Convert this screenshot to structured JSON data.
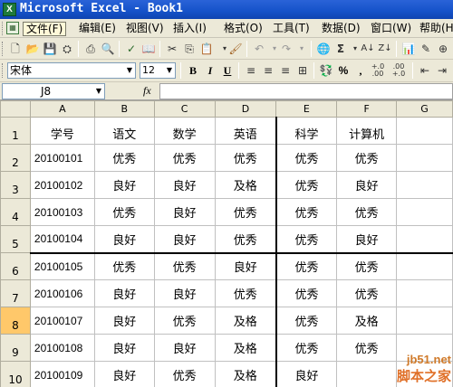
{
  "app": {
    "title": "Microsoft Excel - Book1",
    "icon": "excel-icon"
  },
  "menu": [
    "文件(F)",
    "编辑(E)",
    "视图(V)",
    "插入(I)",
    "格式(O)",
    "工具(T)",
    "数据(D)",
    "窗口(W)",
    "帮助(H)"
  ],
  "format_toolbar": {
    "font": "宋体",
    "size": "12",
    "bold": "B",
    "italic": "I",
    "underline": "U",
    "percent": "%",
    "comma": ",",
    "inc_decimal": "+.0\n.00",
    "dec_decimal": ".00\n+.0"
  },
  "formula_bar": {
    "name_box": "J8",
    "fx": "fx",
    "value": ""
  },
  "columns": [
    "A",
    "B",
    "C",
    "D",
    "E",
    "F",
    "G"
  ],
  "rows": [
    {
      "num": "1",
      "cells": [
        "学号",
        "语文",
        "数学",
        "英语",
        "科学",
        "计算机",
        ""
      ]
    },
    {
      "num": "2",
      "cells": [
        "20100101",
        "优秀",
        "优秀",
        "优秀",
        "优秀",
        "优秀",
        ""
      ]
    },
    {
      "num": "3",
      "cells": [
        "20100102",
        "良好",
        "良好",
        "及格",
        "优秀",
        "良好",
        ""
      ]
    },
    {
      "num": "4",
      "cells": [
        "20100103",
        "优秀",
        "良好",
        "优秀",
        "优秀",
        "优秀",
        ""
      ]
    },
    {
      "num": "5",
      "cells": [
        "20100104",
        "良好",
        "良好",
        "优秀",
        "优秀",
        "良好",
        ""
      ]
    },
    {
      "num": "6",
      "cells": [
        "20100105",
        "优秀",
        "优秀",
        "良好",
        "优秀",
        "优秀",
        ""
      ]
    },
    {
      "num": "7",
      "cells": [
        "20100106",
        "良好",
        "良好",
        "优秀",
        "优秀",
        "优秀",
        ""
      ]
    },
    {
      "num": "8",
      "cells": [
        "20100107",
        "良好",
        "优秀",
        "及格",
        "优秀",
        "及格",
        ""
      ]
    },
    {
      "num": "9",
      "cells": [
        "20100108",
        "良好",
        "良好",
        "及格",
        "优秀",
        "优秀",
        ""
      ]
    },
    {
      "num": "10",
      "cells": [
        "20100109",
        "良好",
        "优秀",
        "及格",
        "良好",
        "",
        ""
      ]
    }
  ],
  "selected_row": "8",
  "watermark": {
    "url": "jb51.net",
    "name": "脚本之家"
  }
}
